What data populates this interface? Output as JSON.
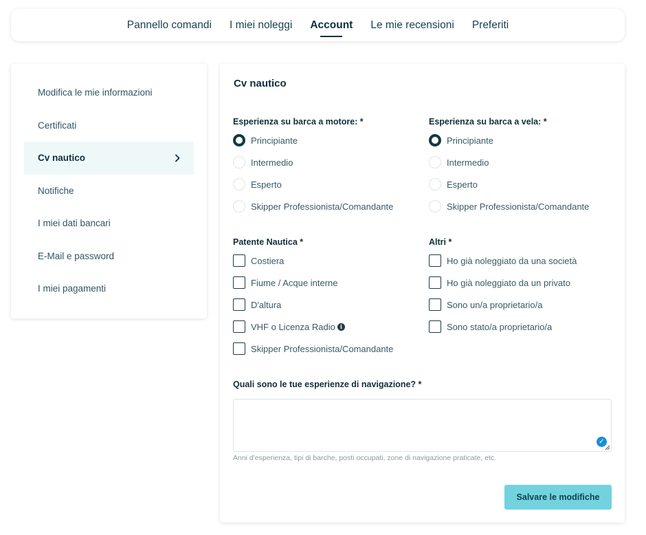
{
  "nav": {
    "tabs": [
      {
        "label": "Pannello comandi"
      },
      {
        "label": "I miei noleggi"
      },
      {
        "label": "Account"
      },
      {
        "label": "Le mie recensioni"
      },
      {
        "label": "Preferiti"
      }
    ],
    "active_tab": "Account"
  },
  "sidebar": {
    "items": [
      {
        "label": "Modifica le mie informazioni"
      },
      {
        "label": "Certificati"
      },
      {
        "label": "Cv nautico"
      },
      {
        "label": "Notifiche"
      },
      {
        "label": "I miei dati bancari"
      },
      {
        "label": "E-Mail e password"
      },
      {
        "label": "I miei pagamenti"
      }
    ],
    "active_item": "Cv nautico"
  },
  "main": {
    "title": "Cv nautico",
    "motor": {
      "label": "Esperienza su barca a motore: *",
      "options": [
        "Principiante",
        "Intermedio",
        "Esperto",
        "Skipper Professionista/Comandante"
      ],
      "selected": "Principiante"
    },
    "sail": {
      "label": "Esperienza su barca a vela: *",
      "options": [
        "Principiante",
        "Intermedio",
        "Esperto",
        "Skipper Professionista/Comandante"
      ],
      "selected": "Principiante"
    },
    "license": {
      "label": "Patente Nautica *",
      "options": [
        "Costiera",
        "Fiume / Acque interne",
        "D'altura",
        "VHF o Licenza Radio",
        "Skipper Professionista/Comandante"
      ]
    },
    "others": {
      "label": "Altri *",
      "options": [
        "Ho già noleggiato da una società",
        "Ho già noleggiato da un privato",
        "Sono un/a proprietario/a",
        "Sono stato/a proprietario/a"
      ]
    },
    "experience": {
      "label": "Quali sono le tue esperienze di navigazione? *",
      "value": "",
      "hint": "Anni d'esperienza, tipi di barche, posti occupati, zone di navigazione praticate, etc."
    },
    "save_label": "Salvare le modifiche"
  },
  "colors": {
    "accent": "#72d3df",
    "text_dark": "#0f2f3b",
    "active_bg": "#eef8f9"
  }
}
